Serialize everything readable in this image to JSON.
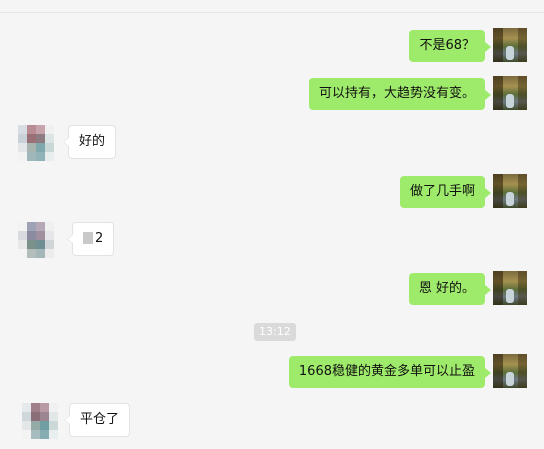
{
  "chat": {
    "messages": [
      {
        "side": "right",
        "text": "不是68？"
      },
      {
        "side": "right",
        "text": "可以持有，大趋势没有变。"
      },
      {
        "side": "left",
        "text": "好的"
      },
      {
        "side": "right",
        "text": "做了几手啊"
      },
      {
        "side": "left",
        "text": "2"
      },
      {
        "side": "right",
        "text": "恩 好的。"
      },
      {
        "side": "right",
        "text": "1668稳健的黄金多单可以止盈"
      },
      {
        "side": "left",
        "text": "平仓了"
      }
    ],
    "timestamp": "13:12"
  },
  "colors": {
    "background": "#f5f5f5",
    "sent_bubble": "#9eea6a",
    "received_bubble": "#ffffff",
    "timestamp_badge": "#dadada"
  },
  "icons": {
    "self_avatar": "self-avatar-icon",
    "contact_avatar": "contact-avatar-icon"
  }
}
